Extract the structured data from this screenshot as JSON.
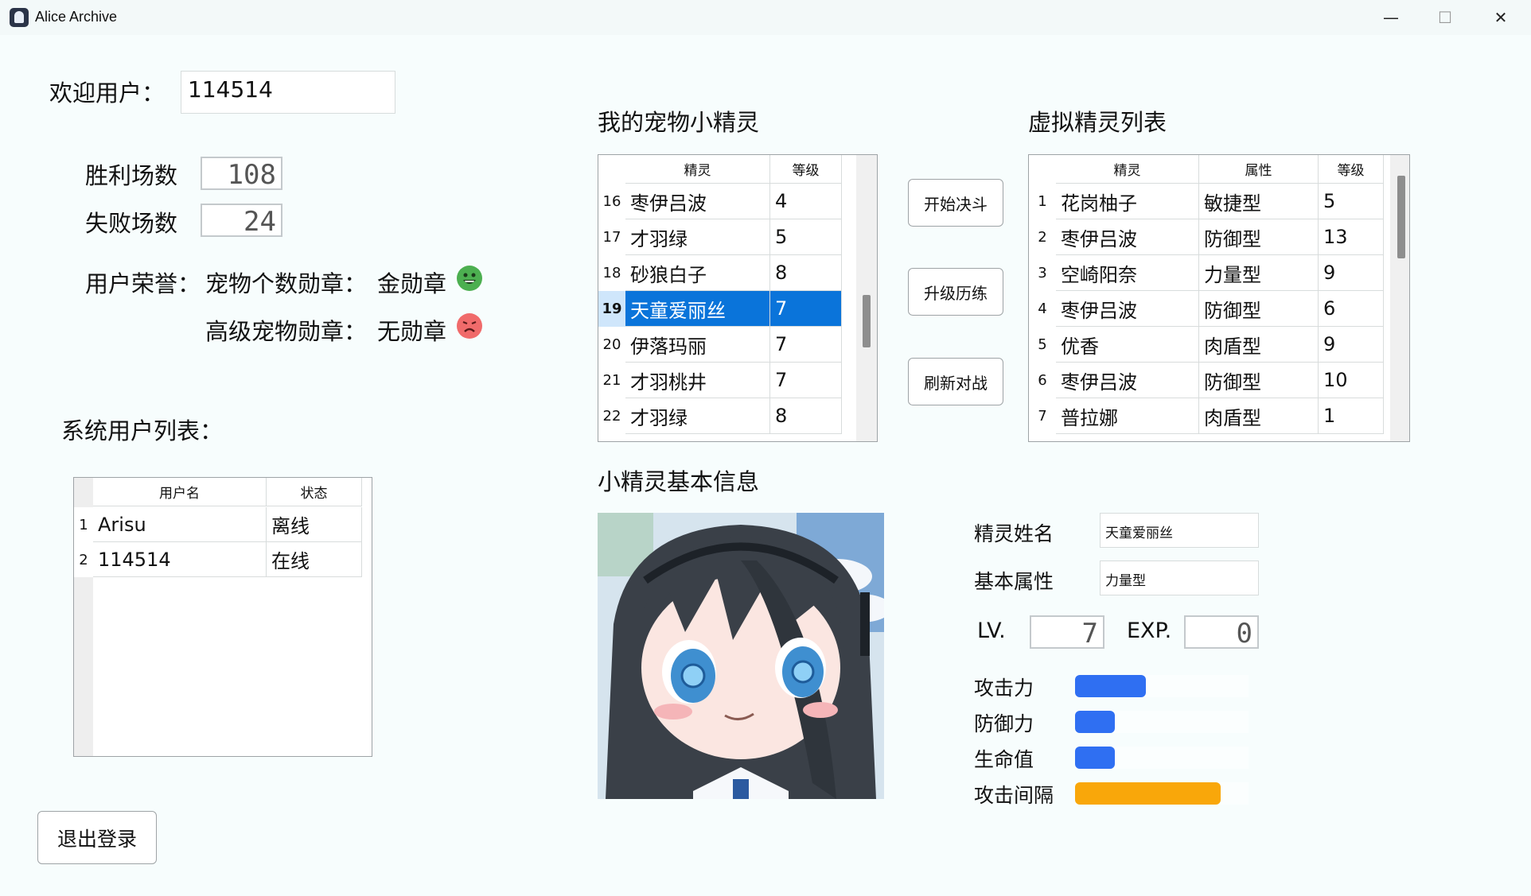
{
  "window": {
    "title": "Alice Archive",
    "minimize": "—",
    "maximize": "☐",
    "close": "✕"
  },
  "welcome": {
    "label": "欢迎用户：",
    "username": "114514"
  },
  "stats": {
    "wins_label": "胜利场数",
    "wins": "108",
    "losses_label": "失败场数",
    "losses": "24"
  },
  "honors": {
    "label": "用户荣誉：",
    "pet_count_badge_label": "宠物个数勋章：",
    "pet_count_badge": "金勋章",
    "pet_count_badge_icon": "grinning-face-icon",
    "high_pet_badge_label": "高级宠物勋章：",
    "high_pet_badge": "无勋章",
    "high_pet_badge_icon": "sad-face-icon"
  },
  "user_list": {
    "title": "系统用户列表：",
    "columns": [
      "用户名",
      "状态"
    ],
    "rows": [
      {
        "num": "1",
        "name": "Arisu",
        "status": "离线"
      },
      {
        "num": "2",
        "name": "114514",
        "status": "在线"
      }
    ]
  },
  "logout_label": "退出登录",
  "my_pets": {
    "title": "我的宠物小精灵",
    "columns": [
      "精灵",
      "等级"
    ],
    "rows": [
      {
        "num": "16",
        "name": "枣伊吕波",
        "level": "4"
      },
      {
        "num": "17",
        "name": "才羽绿",
        "level": "5"
      },
      {
        "num": "18",
        "name": "砂狼白子",
        "level": "8"
      },
      {
        "num": "19",
        "name": "天童爱丽丝",
        "level": "7"
      },
      {
        "num": "20",
        "name": "伊落玛丽",
        "level": "7"
      },
      {
        "num": "21",
        "name": "才羽桃井",
        "level": "7"
      },
      {
        "num": "22",
        "name": "才羽绿",
        "level": "8"
      }
    ],
    "selected_row": "19"
  },
  "actions": {
    "start_duel": "开始决斗",
    "level_train": "升级历练",
    "refresh_battle": "刷新对战"
  },
  "virtual_pets": {
    "title": "虚拟精灵列表",
    "columns": [
      "精灵",
      "属性",
      "等级"
    ],
    "rows": [
      {
        "num": "1",
        "name": "花岗柚子",
        "attr": "敏捷型",
        "level": "5"
      },
      {
        "num": "2",
        "name": "枣伊吕波",
        "attr": "防御型",
        "level": "13"
      },
      {
        "num": "3",
        "name": "空崎阳奈",
        "attr": "力量型",
        "level": "9"
      },
      {
        "num": "4",
        "name": "枣伊吕波",
        "attr": "防御型",
        "level": "6"
      },
      {
        "num": "5",
        "name": "优香",
        "attr": "肉盾型",
        "level": "9"
      },
      {
        "num": "6",
        "name": "枣伊吕波",
        "attr": "防御型",
        "level": "10"
      },
      {
        "num": "7",
        "name": "普拉娜",
        "attr": "肉盾型",
        "level": "1"
      }
    ]
  },
  "pet_info": {
    "title": "小精灵基本信息",
    "name_label": "精灵姓名",
    "name": "天童爱丽丝",
    "attr_label": "基本属性",
    "attr": "力量型",
    "lv_label": "LV.",
    "lv": "7",
    "exp_label": "EXP.",
    "exp": "0",
    "attack_label": "攻击力",
    "defense_label": "防御力",
    "hp_label": "生命值",
    "interval_label": "攻击间隔",
    "attack_level": 0.41,
    "defense_level": 0.23,
    "hp_level": 0.23,
    "interval_level": 0.84,
    "bar_color_blue": "#2f6ff2",
    "bar_color_orange": "#f9a70a"
  }
}
